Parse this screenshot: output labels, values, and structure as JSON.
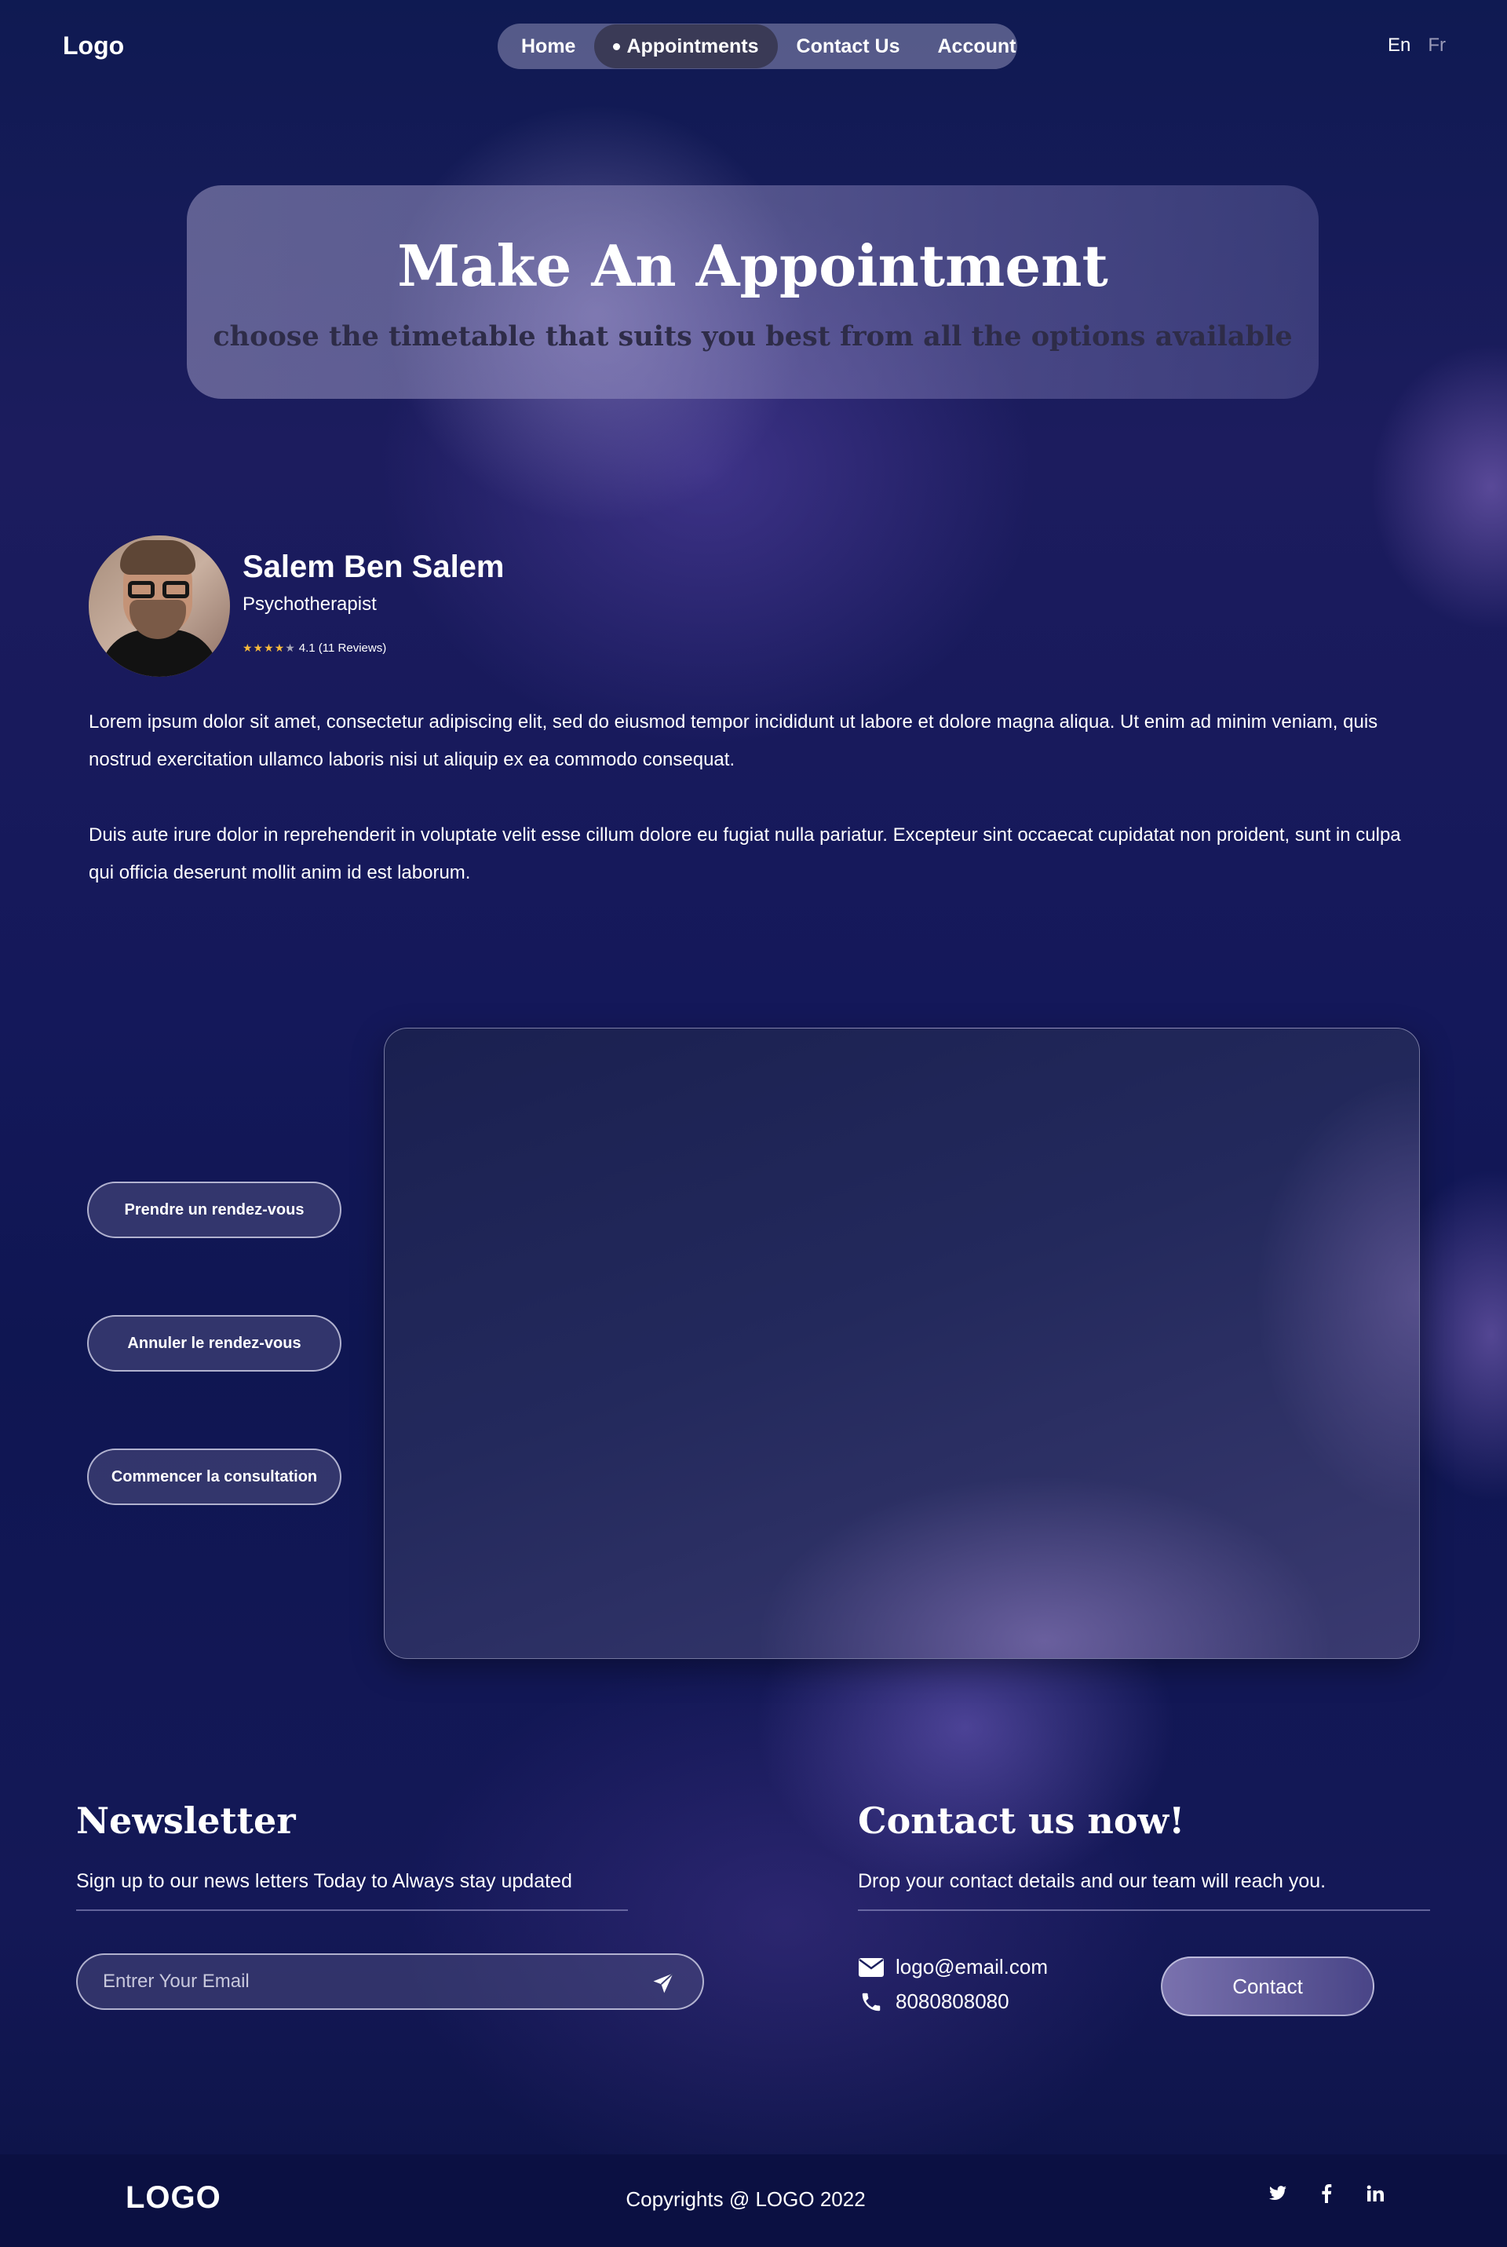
{
  "header": {
    "logo": "Logo",
    "nav": [
      {
        "label": "Home"
      },
      {
        "label": "Appointments",
        "active": true
      },
      {
        "label": "Contact Us"
      },
      {
        "label": "Account"
      }
    ],
    "languages": [
      "En",
      "Fr"
    ],
    "active_language": "En"
  },
  "hero": {
    "title": "Make An Appointment",
    "subtitle": "choose the timetable that suits you best from all the options available"
  },
  "doctor": {
    "name": "Salem Ben Salem",
    "role": "Psychotherapist",
    "rating": 4.1,
    "rating_text": "4.1 (11 Reviews)",
    "reviews": 11,
    "paragraphs": [
      "Lorem ipsum dolor sit amet, consectetur adipiscing elit, sed do eiusmod tempor incididunt ut labore et dolore magna aliqua. Ut enim ad minim veniam, quis nostrud exercitation ullamco laboris nisi ut aliquip ex ea commodo consequat.",
      "Duis aute irure dolor in reprehenderit in voluptate velit esse cillum dolore eu fugiat nulla pariatur. Excepteur sint occaecat cupidatat non proident, sunt in culpa qui officia deserunt mollit anim id est laborum."
    ]
  },
  "actions": [
    {
      "label": "Prendre un rendez-vous"
    },
    {
      "label": "Annuler le rendez-vous"
    },
    {
      "label": "Commencer la consultation"
    }
  ],
  "newsletter": {
    "title": "Newsletter",
    "text": "Sign up to our news letters Today to Always stay updated",
    "email_placeholder": "Entrer Your Email",
    "email_value": ""
  },
  "contact": {
    "title": "Contact us now!",
    "text": "Drop your contact details and our team will reach you.",
    "email": "logo@email.com",
    "phone": "8080808080",
    "button": "Contact"
  },
  "footer": {
    "logo": "LOGO",
    "copyright": "Copyrights @ LOGO 2022",
    "socials": [
      "twitter-icon",
      "facebook-icon",
      "linkedin-icon"
    ]
  },
  "colors": {
    "background": "#141857",
    "star": "#f6b93b",
    "bottom_bar": "#0b1042",
    "nav_active": "#3a3a56"
  }
}
